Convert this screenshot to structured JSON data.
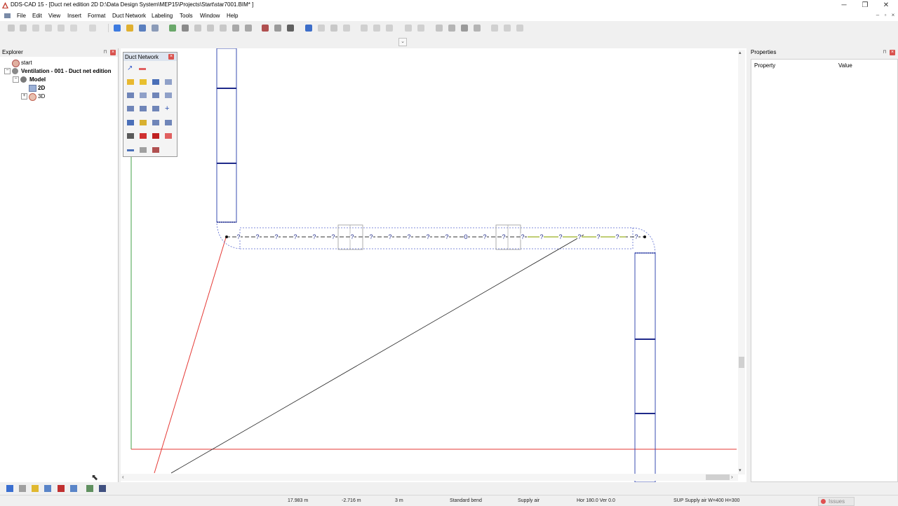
{
  "window": {
    "title": "DDS-CAD 15 - [Duct net edition  2D  D:\\Data Design System\\MEP15\\Projects\\Start\\star7001.BIM* ]",
    "controls": [
      "─",
      "❐",
      "✕"
    ]
  },
  "menu": [
    "File",
    "Edit",
    "View",
    "Insert",
    "Format",
    "Duct Network",
    "Labeling",
    "Tools",
    "Window",
    "Help"
  ],
  "mdi_controls": [
    "‒",
    "▫",
    "×"
  ],
  "explorer": {
    "title": "Explorer",
    "tree": {
      "root": "start",
      "project": "Ventilation - 001 - Duct net edition",
      "model": "Model",
      "view_2d": "2D",
      "view_3d": "3D"
    }
  },
  "duct_palette": {
    "title": "Duct Network"
  },
  "properties": {
    "title": "Properties",
    "col_property": "Property",
    "col_value": "Value"
  },
  "drawing": {
    "duct_markers": [
      "?",
      "?",
      "?",
      "?",
      "?",
      "?",
      "?",
      "?",
      "?",
      "?",
      "?",
      "?",
      "0",
      "?",
      "?",
      "?",
      "?",
      "?",
      "?",
      "?",
      "?",
      "?"
    ],
    "colors": {
      "duct": "#1f2a8a",
      "red_line": "#e53935",
      "green_line": "#43a047",
      "accent": "#3a5fcd"
    }
  },
  "status": {
    "x": "17.983 m",
    "y": "-2.716 m",
    "grid": "3 m",
    "object": "Standard bend",
    "system": "Supply air",
    "angle": "Hor 180.0 Ver  0.0",
    "description": "SUP Supply air W=400 H=300",
    "issues": "Issues"
  }
}
